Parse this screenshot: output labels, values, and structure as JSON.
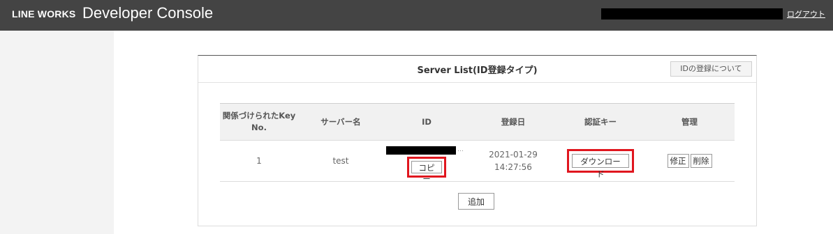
{
  "header": {
    "brand": "LINE WORKS",
    "title": "Developer Console",
    "logout_label": "ログアウト"
  },
  "panel": {
    "title": "Server List(ID登録タイプ)",
    "help_label": "IDの登録について"
  },
  "table": {
    "columns": [
      "関係づけられたKey No.",
      "サーバー名",
      "ID",
      "登録日",
      "認証キー",
      "管理"
    ],
    "rows": [
      {
        "key_no": "1",
        "server_name": "test",
        "id_ellipsis": "…",
        "copy_label": "コピー",
        "registered_date": "2021-01-29",
        "registered_time": "14:27:56",
        "download_label": "ダウンロード",
        "edit_label": "修正",
        "delete_label": "削除"
      }
    ]
  },
  "add_label": "追加",
  "colors": {
    "header_bg": "#444444",
    "sidebar_bg": "#f3f3f3",
    "highlight": "#e0161e"
  }
}
